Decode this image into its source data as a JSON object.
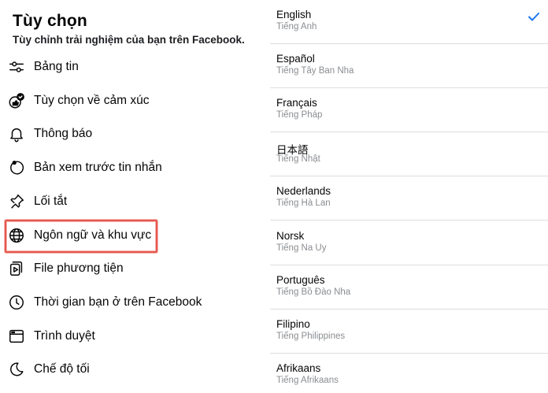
{
  "settings": {
    "title": "Tùy chọn",
    "subtitle": "Tùy chỉnh trải nghiệm của bạn trên Facebook.",
    "items": [
      {
        "label": "Bảng tin",
        "icon": "sliders-icon"
      },
      {
        "label": "Tùy chọn về cảm xúc",
        "icon": "reaction-icon"
      },
      {
        "label": "Thông báo",
        "icon": "bell-icon"
      },
      {
        "label": "Bản xem trước tin nhắn",
        "icon": "message-preview-icon"
      },
      {
        "label": "Lối tắt",
        "icon": "pin-icon"
      },
      {
        "label": "Ngôn ngữ và khu vực",
        "icon": "globe-icon"
      },
      {
        "label": "File phương tiện",
        "icon": "media-icon"
      },
      {
        "label": "Thời gian bạn ở trên Facebook",
        "icon": "clock-icon"
      },
      {
        "label": "Trình duyệt",
        "icon": "browser-icon"
      },
      {
        "label": "Chế độ tối",
        "icon": "moon-icon"
      }
    ],
    "highlight_color": "#e4574e"
  },
  "languages": {
    "items": [
      {
        "name": "English",
        "native": "Tiếng Anh",
        "selected": true
      },
      {
        "name": "Español",
        "native": "Tiếng Tây Ban Nha",
        "selected": false
      },
      {
        "name": "Français",
        "native": "Tiếng Pháp",
        "selected": false
      },
      {
        "name": "日本語",
        "native": "Tiếng Nhật",
        "selected": false
      },
      {
        "name": "Nederlands",
        "native": "Tiếng Hà Lan",
        "selected": false
      },
      {
        "name": "Norsk",
        "native": "Tiếng Na Uy",
        "selected": false
      },
      {
        "name": "Português",
        "native": "Tiếng Bồ Đào Nha",
        "selected": false
      },
      {
        "name": "Filipino",
        "native": "Tiếng Philippines",
        "selected": false
      },
      {
        "name": "Afrikaans",
        "native": "Tiếng Afrikaans",
        "selected": false
      }
    ],
    "check_color": "#1877f2"
  }
}
